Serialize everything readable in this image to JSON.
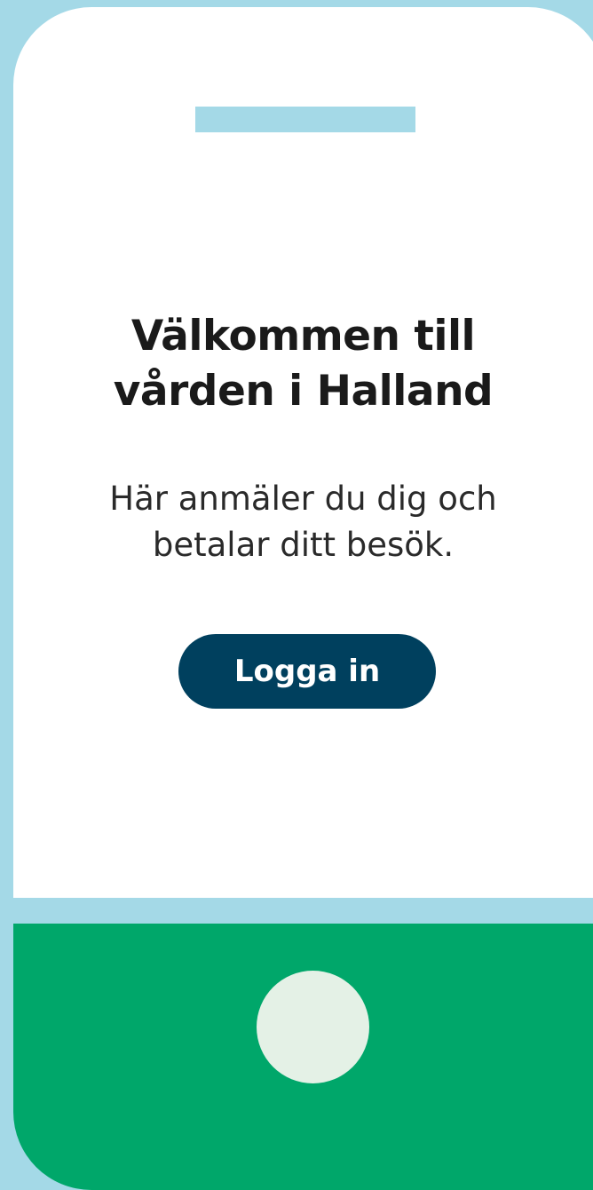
{
  "welcome": {
    "title_line1": "Välkommen till",
    "title_line2": "vården i Halland",
    "subtitle_line1": "Här anmäler du dig och",
    "subtitle_line2": "betalar ditt besök."
  },
  "actions": {
    "login_label": "Logga in"
  },
  "colors": {
    "frame": "#a4d9e7",
    "screen": "#ffffff",
    "button": "#00405e",
    "bottom": "#00a76a",
    "home_button": "#e4f1e6"
  },
  "icons": {
    "speaker": "speaker-bar-icon",
    "home": "home-button-icon"
  }
}
